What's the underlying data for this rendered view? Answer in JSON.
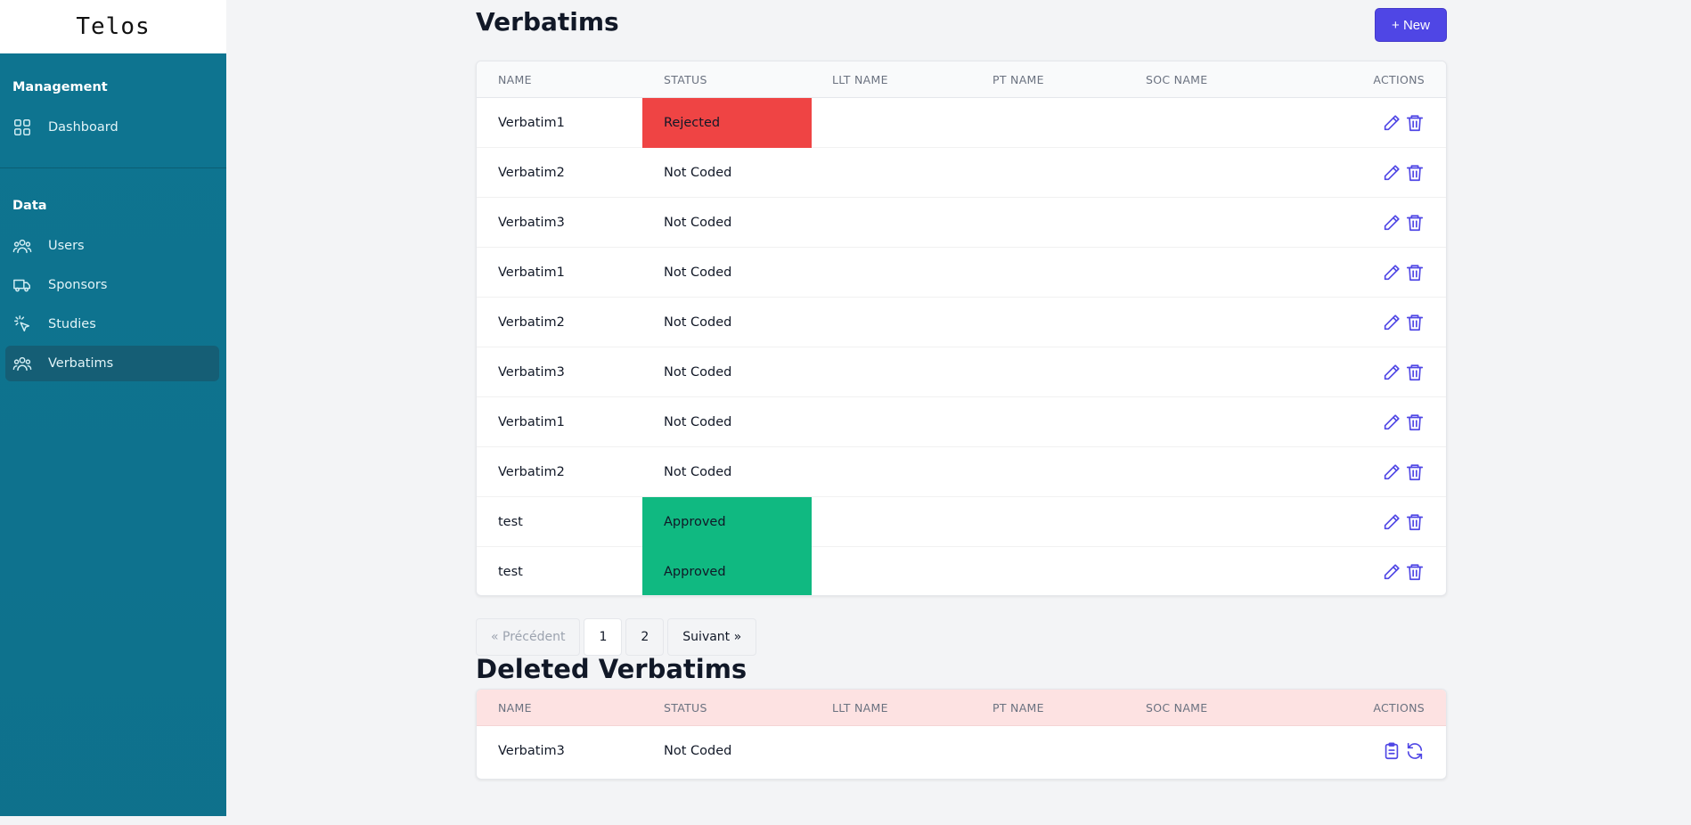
{
  "app": {
    "name": "Telos"
  },
  "sidebar": {
    "sections": [
      {
        "heading": "Management",
        "items": [
          {
            "label": "Dashboard",
            "icon": "grid-icon"
          }
        ]
      },
      {
        "heading": "Data",
        "items": [
          {
            "label": "Users",
            "icon": "users-icon"
          },
          {
            "label": "Sponsors",
            "icon": "truck-icon"
          },
          {
            "label": "Studies",
            "icon": "cursor-click-icon"
          },
          {
            "label": "Verbatims",
            "icon": "users-icon",
            "active": true
          }
        ]
      }
    ]
  },
  "main": {
    "title": "Verbatims",
    "new_button": "+ New",
    "columns": [
      "NAME",
      "STATUS",
      "LLT NAME",
      "PT NAME",
      "SOC NAME",
      "ACTIONS"
    ],
    "rows": [
      {
        "name": "Verbatim1",
        "status": "Rejected",
        "status_color": "#ef4444"
      },
      {
        "name": "Verbatim2",
        "status": "Not Coded"
      },
      {
        "name": "Verbatim3",
        "status": "Not Coded"
      },
      {
        "name": "Verbatim1",
        "status": "Not Coded"
      },
      {
        "name": "Verbatim2",
        "status": "Not Coded"
      },
      {
        "name": "Verbatim3",
        "status": "Not Coded"
      },
      {
        "name": "Verbatim1",
        "status": "Not Coded"
      },
      {
        "name": "Verbatim2",
        "status": "Not Coded"
      },
      {
        "name": "test",
        "status": "Approved",
        "status_color": "#10b981"
      },
      {
        "name": "test",
        "status": "Approved",
        "status_color": "#10b981"
      }
    ],
    "pagination": {
      "prev": "« Précédent",
      "pages": [
        "1",
        "2"
      ],
      "current": "1",
      "next": "Suivant »"
    }
  },
  "deleted": {
    "title": "Deleted Verbatims",
    "columns": [
      "NAME",
      "STATUS",
      "LLT NAME",
      "PT NAME",
      "SOC NAME",
      "ACTIONS"
    ],
    "rows": [
      {
        "name": "Verbatim3",
        "status": "Not Coded"
      }
    ]
  },
  "colors": {
    "sidebar": "#0e7490",
    "accent": "#4f46e5",
    "rejected": "#ef4444",
    "approved": "#10b981",
    "deleted_header": "#fde2e2"
  }
}
